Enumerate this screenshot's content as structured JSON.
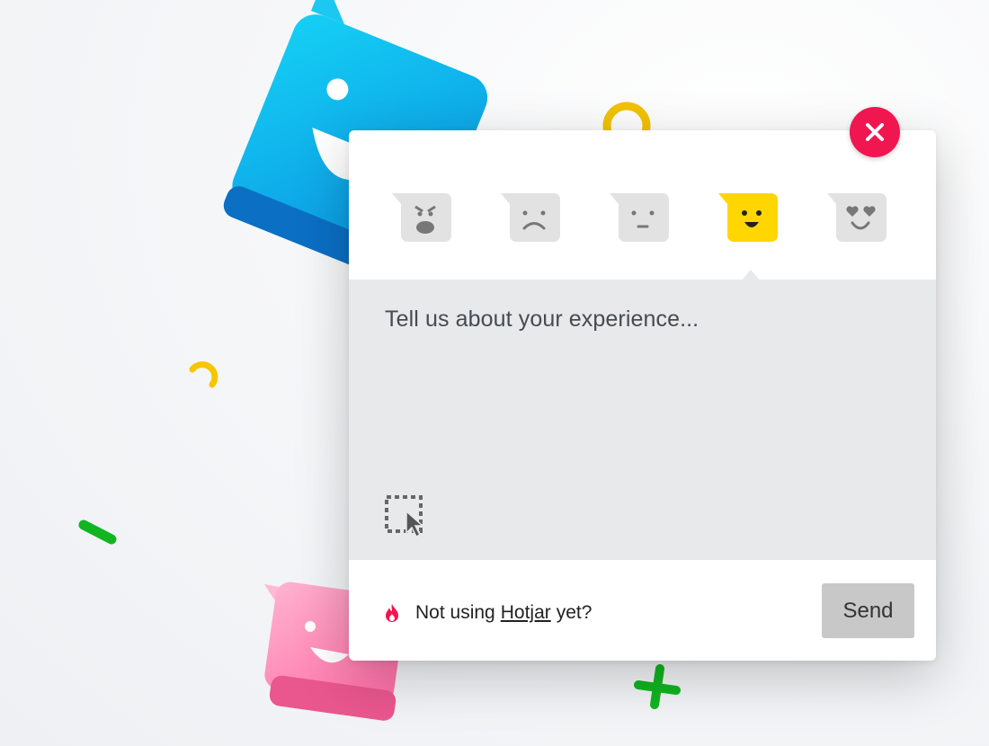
{
  "widget": {
    "feedback_placeholder": "Tell us about your experience...",
    "promo_prefix": "Not using",
    "promo_link": "Hotjar",
    "promo_suffix": "yet?",
    "send_label": "Send",
    "selected_rating": "happy"
  },
  "ratings": [
    {
      "name": "angry",
      "icon": "angry-face-icon"
    },
    {
      "name": "sad",
      "icon": "sad-face-icon"
    },
    {
      "name": "neutral",
      "icon": "neutral-face-icon"
    },
    {
      "name": "happy",
      "icon": "happy-face-icon"
    },
    {
      "name": "love",
      "icon": "heart-eyes-face-icon"
    }
  ],
  "colors": {
    "close": "#f0164f",
    "selected": "#ffd600",
    "unselected": "#e2e2e2",
    "feedback_bg": "#e8e9eb",
    "send_bg": "#c8c8c8",
    "brand_flame": "#f0164f"
  }
}
